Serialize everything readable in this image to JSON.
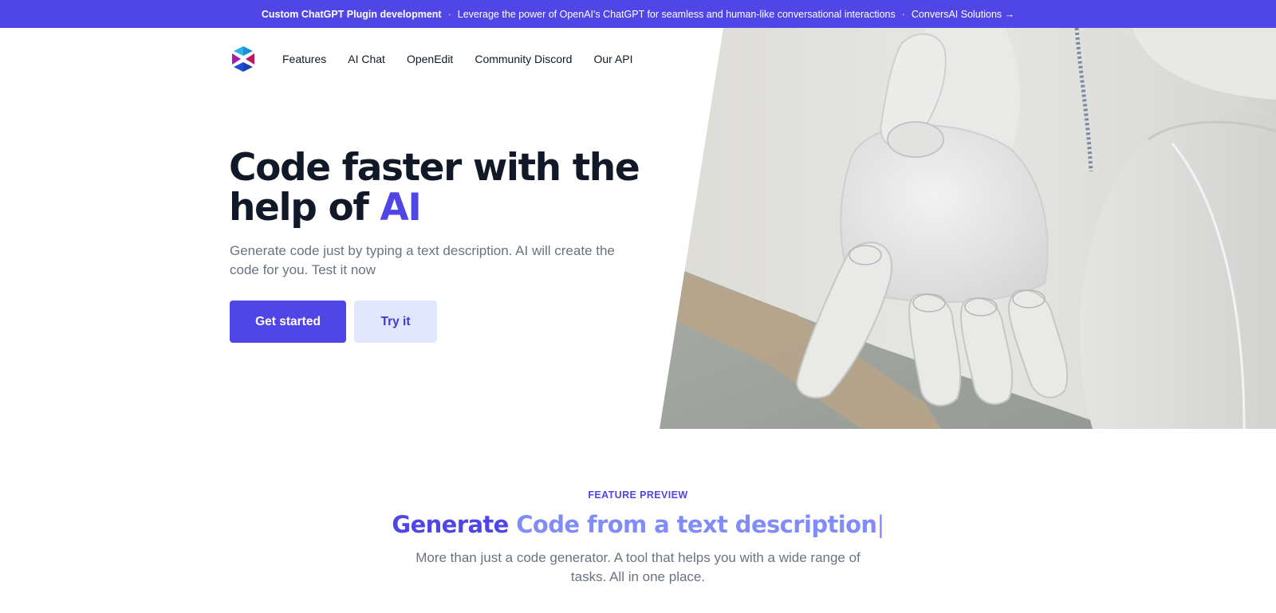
{
  "banner": {
    "title": "Custom ChatGPT Plugin development",
    "separator": "·",
    "message": "Leverage the power of OpenAI's ChatGPT for seamless and human-like conversational interactions",
    "link_label": "ConversAI Solutions →"
  },
  "nav": {
    "logo_icon": "hexagon-logo-icon",
    "items": [
      {
        "label": "Features"
      },
      {
        "label": "AI Chat"
      },
      {
        "label": "OpenEdit"
      },
      {
        "label": "Community Discord"
      },
      {
        "label": "Our API"
      }
    ]
  },
  "hero": {
    "title_line1": "Code faster with the",
    "title_line2_prefix": "help of ",
    "title_accent": "AI",
    "subtitle": "Generate code just by typing a text description. AI will create the code for you. Test it now",
    "primary_button": "Get started",
    "secondary_button": "Try it",
    "image_alt": "White robotic hand reaching out"
  },
  "feature": {
    "eyebrow": "FEATURE PREVIEW",
    "title_prefix": "Generate",
    "title_typed": "Code from a text description",
    "caret": "|",
    "subtitle": "More than just a code generator. A tool that helps you with a wide range of tasks. All in one place."
  },
  "colors": {
    "brand": "#4f46e5",
    "brand_light": "#818cf8",
    "secondary_bg": "#e0e7ff",
    "text_dark": "#111827",
    "text_muted": "#6b7280"
  }
}
